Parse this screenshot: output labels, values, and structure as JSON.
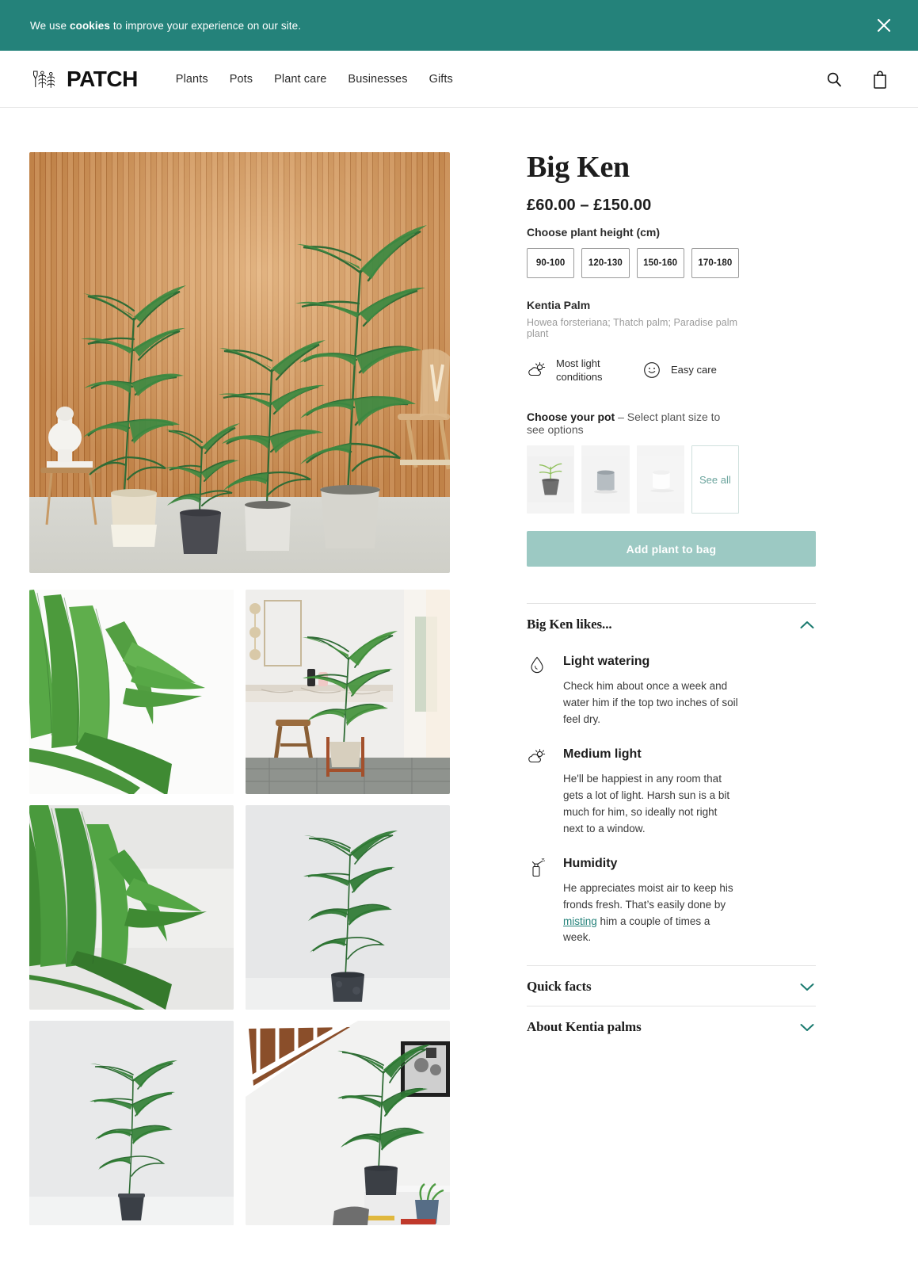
{
  "cookie_banner": {
    "text_before": "We use ",
    "text_bold": "cookies",
    "text_after": " to improve your experience on our site.",
    "close_icon": "close-icon",
    "background_color": "#24827a"
  },
  "header": {
    "brand": "PATCH",
    "nav": [
      {
        "label": "Plants"
      },
      {
        "label": "Pots"
      },
      {
        "label": "Plant care"
      },
      {
        "label": "Businesses"
      },
      {
        "label": "Gifts"
      }
    ],
    "icons": [
      {
        "name": "search-icon"
      },
      {
        "name": "shopping-bag-icon"
      }
    ]
  },
  "product": {
    "title": "Big Ken",
    "price": "£60.00 – £150.00",
    "height_label": "Choose plant height (cm)",
    "height_options": [
      "90-100",
      "120-130",
      "150-160",
      "170-180"
    ],
    "common_name": "Kentia Palm",
    "latin_name": "Howea forsteriana; Thatch palm; Paradise palm plant",
    "attributes": [
      {
        "icon": "sun-cloud-icon",
        "label": "Most light conditions"
      },
      {
        "icon": "smiley-face-icon",
        "label": "Easy care"
      }
    ],
    "pot_label_bold": "Choose your pot",
    "pot_label_rest": " – Select plant size to see options",
    "pot_see_all": "See all",
    "add_to_bag": "Add plant to bag",
    "add_to_bag_color": "#9cc9c3"
  },
  "likes_section": {
    "title": "Big Ken likes...",
    "expanded": true,
    "chevron": "chevron-up-icon",
    "items": [
      {
        "icon": "water-drop-icon",
        "title": "Light watering",
        "text": "Check him about once a week and water him if the top two inches of soil feel dry."
      },
      {
        "icon": "sun-cloud-icon",
        "title": "Medium light",
        "text": "He'll be happiest in any room that gets a lot of light. Harsh sun is a bit much for him, so ideally not right next to a window."
      },
      {
        "icon": "spray-bottle-icon",
        "title": "Humidity",
        "text_before": "He appreciates moist air to keep his fronds fresh. That’s easily done by ",
        "link": "misting",
        "text_after": " him a couple of times a week."
      }
    ]
  },
  "accordions": [
    {
      "title": "Quick facts",
      "chevron": "chevron-down-icon"
    },
    {
      "title": "About Kentia palms",
      "chevron": "chevron-down-icon"
    }
  ],
  "gallery": {
    "hero_alt": "kentia-palms-row-against-wood-slat-wall",
    "thumbs": [
      {
        "alt": "palm-fronds-closeup"
      },
      {
        "alt": "palm-in-bathroom-on-wooden-stand"
      },
      {
        "alt": "palm-fronds-closeup-grey-background"
      },
      {
        "alt": "palm-in-dark-pot-studio"
      },
      {
        "alt": "palm-in-nursery-pot-studio"
      },
      {
        "alt": "palm-beside-staircase-in-hallway"
      }
    ]
  }
}
